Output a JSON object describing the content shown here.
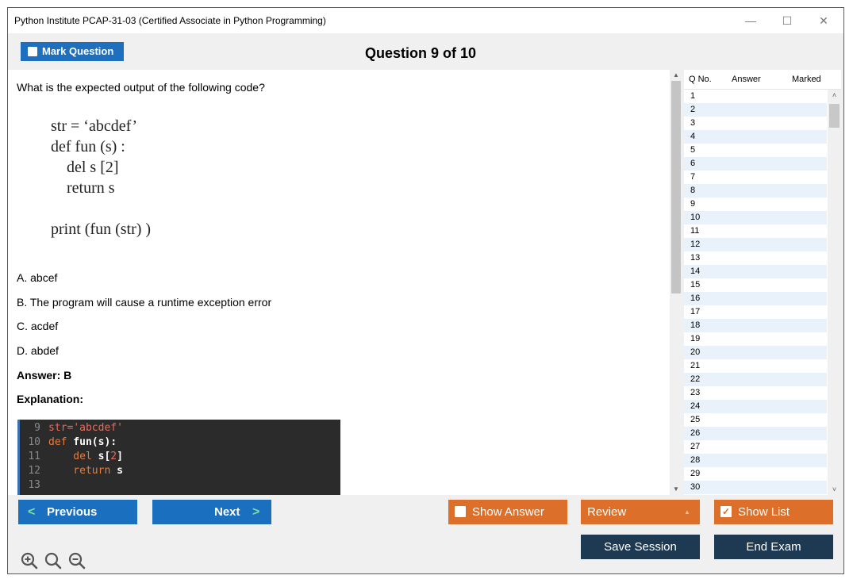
{
  "window": {
    "title": "Python Institute PCAP-31-03 (Certified Associate in Python Programming)",
    "minimize_glyph": "—",
    "maximize_glyph": "☐",
    "close_glyph": "✕"
  },
  "toolbar": {
    "mark_question_label": "Mark Question",
    "question_counter": "Question 9 of 10"
  },
  "question": {
    "prompt": "What is the expected output of the following code?",
    "code_lines": [
      "str = ‘abcdef’",
      "def fun (s) :",
      "    del s [2]",
      "    return s",
      "",
      "print (fun (str) )"
    ],
    "options": [
      "A. abcef",
      "B. The program will cause a runtime exception error",
      "C. acdef",
      "D. abdef"
    ],
    "answer_label": "Answer: B",
    "explanation_label": "Explanation:"
  },
  "ide_snippet": {
    "line_numbers": [
      "9",
      "10",
      "11",
      "12",
      "13"
    ],
    "lines": [
      {
        "a": "str",
        "b": "=",
        "c": "'abcdef'"
      },
      {
        "a": "def",
        "b": " fun(s):",
        "c": ""
      },
      {
        "a": "    del",
        "b": " s[",
        "c": "2",
        "d": "]"
      },
      {
        "a": "    return",
        "b": " s",
        "c": ""
      },
      {
        "a": "",
        "b": "",
        "c": ""
      }
    ]
  },
  "question_list": {
    "columns": [
      "Q No.",
      "Answer",
      "Marked"
    ],
    "rows": [
      "1",
      "2",
      "3",
      "4",
      "5",
      "6",
      "7",
      "8",
      "9",
      "10",
      "11",
      "12",
      "13",
      "14",
      "15",
      "16",
      "17",
      "18",
      "19",
      "20",
      "21",
      "22",
      "23",
      "24",
      "25",
      "26",
      "27",
      "28",
      "29",
      "30"
    ]
  },
  "footer": {
    "previous_label": "Previous",
    "next_label": "Next",
    "show_answer_label": "Show Answer",
    "review_label": "Review",
    "show_list_label": "Show List",
    "save_session_label": "Save Session",
    "end_exam_label": "End Exam",
    "show_list_checked": true,
    "show_answer_checked": false
  },
  "colors": {
    "primary_blue": "#1a6fbe",
    "accent_orange": "#dc6f2a",
    "dark_navy": "#1d3a52",
    "row_alt": "#e9f2fb"
  },
  "icons": [
    "zoom-in-icon",
    "zoom-reset-icon",
    "zoom-out-icon",
    "chevron-left-icon",
    "chevron-right-icon",
    "check-icon"
  ]
}
